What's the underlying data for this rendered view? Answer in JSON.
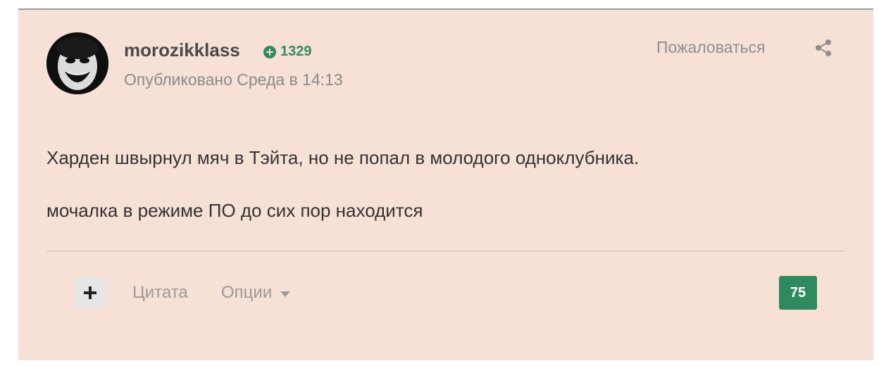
{
  "post": {
    "author": "morozikklass",
    "reputation": "1329",
    "published": "Опубликовано Среда в 14:13",
    "report": "Пожаловаться",
    "content": {
      "line1": "Харден швырнул мяч в Тэйта, но не попал в молодого одноклубника.",
      "line2": "мочалка в режиме ПО до сих пор находится"
    },
    "actions": {
      "quote": "Цитата",
      "options": "Опции"
    },
    "score": "75"
  },
  "colors": {
    "card_bg": "#f7e0d6",
    "accent_green": "#2f8a5f"
  },
  "icons": [
    "avatar-image",
    "plus-circle-icon",
    "share-icon",
    "plus-icon",
    "chevron-down-icon"
  ]
}
